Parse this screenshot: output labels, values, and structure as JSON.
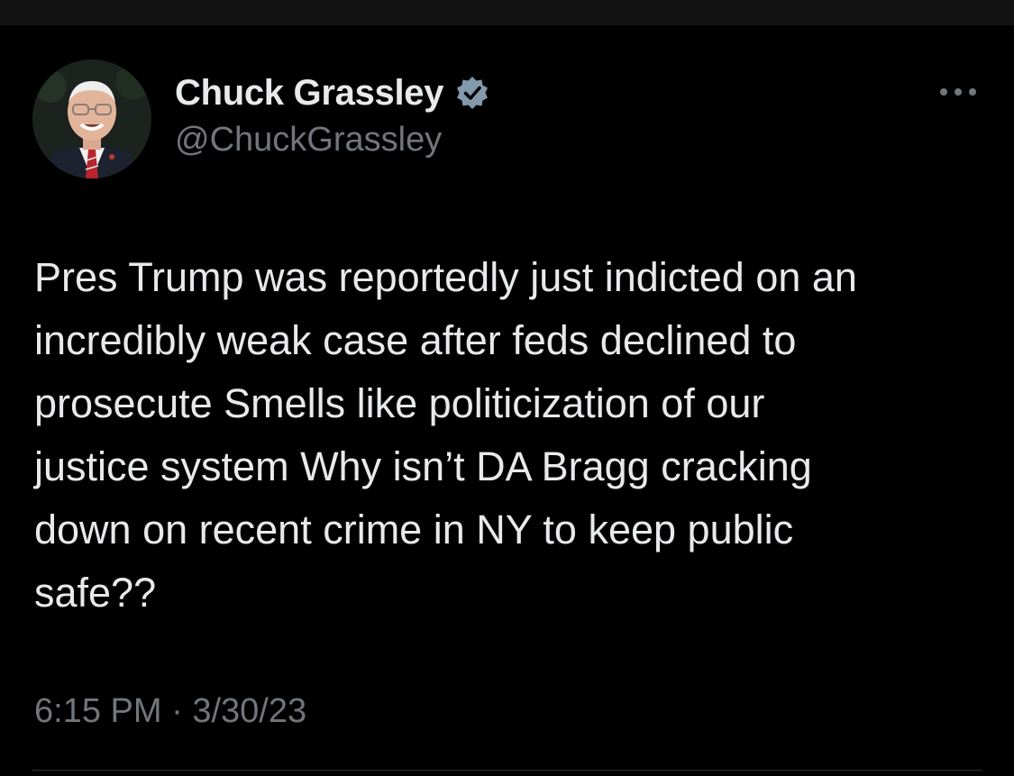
{
  "author": {
    "display_name": "Chuck Grassley",
    "handle": "@ChuckGrassley",
    "verified": true,
    "avatar_icon": "profile-photo"
  },
  "menu": {
    "icon": "more-options-icon"
  },
  "tweet": {
    "lines": [
      "Pres Trump was reportedly just indicted on an",
      "incredibly weak case after feds declined to",
      "prosecute Smells like politicization of our",
      "justice system Why isn’t DA Bragg cracking",
      "down on recent crime in NY to keep public",
      "safe??"
    ],
    "time": "6:15 PM",
    "separator": "·",
    "date": "3/30/23"
  },
  "colors": {
    "background": "#000000",
    "text_primary": "#e7e9ea",
    "text_secondary": "#71767b",
    "verified_badge": "#829aab",
    "divider": "#2f3336"
  }
}
